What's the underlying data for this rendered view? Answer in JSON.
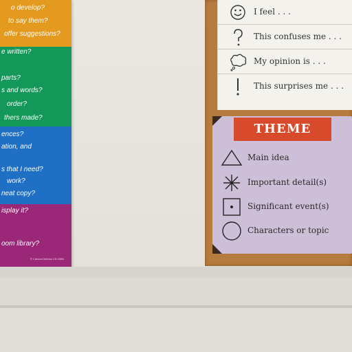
{
  "left_chart": {
    "orange_lines": [
      "o develop?",
      "to say them?",
      "offer suggestions?"
    ],
    "green_lines": [
      "e written?",
      "parts?",
      "s and words?",
      "order?",
      "thers made?"
    ],
    "blue_lines": [
      "ences?",
      "ation, and",
      "s that I need?",
      "work?",
      "neat copy?"
    ],
    "purple_lines": [
      "isplay it?",
      "oom library?"
    ],
    "footer_note": "© Carson-Dellosa CD-1086"
  },
  "sentence_starters": [
    {
      "icon": "smiley-icon",
      "text": "I feel . . ."
    },
    {
      "icon": "question-mark-icon",
      "text": "This confuses me . . ."
    },
    {
      "icon": "thought-cloud-icon",
      "text": "My opinion is . . ."
    },
    {
      "icon": "exclamation-icon",
      "text": "This surprises me . . ."
    }
  ],
  "theme_card": {
    "title": "THEME",
    "items": [
      {
        "icon": "triangle-icon",
        "label": "Main idea"
      },
      {
        "icon": "asterisk-icon",
        "label": "Important detail(s)"
      },
      {
        "icon": "dotted-square-icon",
        "label": "Significant event(s)"
      },
      {
        "icon": "circle-icon",
        "label": "Characters or topic"
      }
    ]
  },
  "colors": {
    "orange": "#e39a1f",
    "green": "#14985a",
    "blue": "#1f6fc4",
    "purple": "#9a2778",
    "theme_banner": "#d74b2c",
    "theme_card": "#cdbfd8",
    "cork": "#b67b3f"
  }
}
